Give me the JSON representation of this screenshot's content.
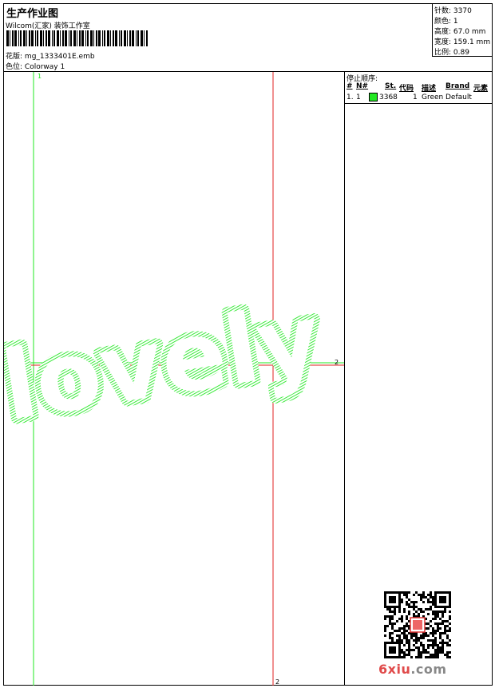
{
  "header": {
    "title": "生产作业图",
    "subtitle": "Wilcom(汇家) 装饰工作室",
    "pattern_label": "花版:",
    "pattern_value": "mg_1333401E.emb",
    "colorway_label": "色位:",
    "colorway_value": "Colorway 1"
  },
  "stats": [
    {
      "label": "针数:",
      "value": "3370"
    },
    {
      "label": "颜色:",
      "value": "1"
    },
    {
      "label": "高度:",
      "value": "67.0 mm"
    },
    {
      "label": "宽度:",
      "value": "159.1 mm"
    },
    {
      "label": "比例:",
      "value": "0.89"
    }
  ],
  "canvas": {
    "design_text": "lovely",
    "stitch_color": "#22e822",
    "markers": {
      "v_green": "1",
      "h_green": "1",
      "v_red": "2",
      "h_red": "2"
    }
  },
  "stop_sequence": {
    "title": "停止顺序:",
    "columns": [
      "#",
      "N#",
      "St.",
      "代码",
      "描述",
      "Brand",
      "元素"
    ],
    "rows": [
      {
        "num": "1.",
        "needle": "1",
        "stitches": "3368",
        "code": "1",
        "desc": "Green",
        "brand": "Default",
        "element": ""
      }
    ]
  },
  "logo": {
    "text_a": "6",
    "text_b": "xiu",
    "text_c": ".com"
  }
}
